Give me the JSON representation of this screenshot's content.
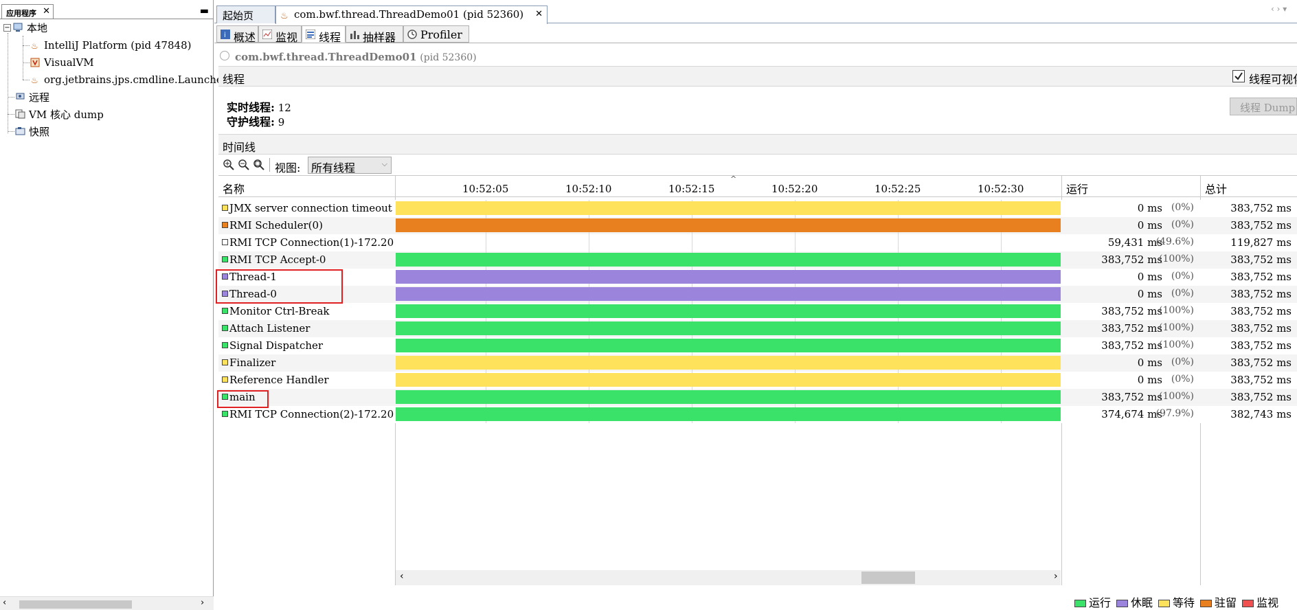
{
  "left_panel": {
    "tab_label": "应用程序",
    "tree": {
      "local": "本地",
      "local_items": [
        "IntelliJ Platform (pid 47848)",
        "VisualVM",
        "org.jetbrains.jps.cmdline.Launcher"
      ],
      "remote": "远程",
      "coredump": "VM 核心 dump",
      "snapshot": "快照"
    }
  },
  "doc_tabs": [
    {
      "label": "起始页"
    },
    {
      "label": "com.bwf.thread.ThreadDemo01 (pid 52360)"
    }
  ],
  "sub_tabs": [
    "概述",
    "监视",
    "线程",
    "抽样器",
    "Profiler"
  ],
  "app_header": "com.bwf.thread.ThreadDemo01",
  "app_pid": "(pid 52360)",
  "threads_section": {
    "title": "线程",
    "visual_checkbox_label": "线程可视化",
    "visual_checked": true,
    "live_label": "实时线程:",
    "live_value": "12",
    "daemon_label": "守护线程:",
    "daemon_value": "9",
    "dump_button": "线程 Dump"
  },
  "timeline": {
    "title": "时间线",
    "view_label": "视图:",
    "view_value": "所有线程",
    "columns": {
      "name": "名称",
      "running": "运行",
      "total": "总计"
    },
    "ticks": [
      "10:52:05",
      "10:52:10",
      "10:52:15",
      "10:52:20",
      "10:52:25",
      "10:52:30"
    ]
  },
  "colors": {
    "running": "#3ae26a",
    "sleeping": "#9b84dc",
    "waiting": "#ffe25c",
    "parked": "#e88020",
    "monitor": "#f05050"
  },
  "threads": [
    {
      "name": "JMX server connection timeout",
      "state": "waiting",
      "running": "0 ms",
      "pct": "(0%)",
      "total": "383,752 ms"
    },
    {
      "name": "RMI Scheduler(0)",
      "state": "parked",
      "running": "0 ms",
      "pct": "(0%)",
      "total": "383,752 ms"
    },
    {
      "name": "RMI TCP Connection(1)-172.20",
      "state": "none",
      "running": "59,431 ms",
      "pct": "(49.6%)",
      "total": "119,827 ms"
    },
    {
      "name": "RMI TCP Accept-0",
      "state": "running",
      "running": "383,752 ms",
      "pct": "(100%)",
      "total": "383,752 ms"
    },
    {
      "name": "Thread-1",
      "state": "sleeping",
      "running": "0 ms",
      "pct": "(0%)",
      "total": "383,752 ms"
    },
    {
      "name": "Thread-0",
      "state": "sleeping",
      "running": "0 ms",
      "pct": "(0%)",
      "total": "383,752 ms"
    },
    {
      "name": "Monitor Ctrl-Break",
      "state": "running",
      "running": "383,752 ms",
      "pct": "(100%)",
      "total": "383,752 ms"
    },
    {
      "name": "Attach Listener",
      "state": "running",
      "running": "383,752 ms",
      "pct": "(100%)",
      "total": "383,752 ms"
    },
    {
      "name": "Signal Dispatcher",
      "state": "running",
      "running": "383,752 ms",
      "pct": "(100%)",
      "total": "383,752 ms"
    },
    {
      "name": "Finalizer",
      "state": "waiting",
      "running": "0 ms",
      "pct": "(0%)",
      "total": "383,752 ms"
    },
    {
      "name": "Reference Handler",
      "state": "waiting",
      "running": "0 ms",
      "pct": "(0%)",
      "total": "383,752 ms"
    },
    {
      "name": "main",
      "state": "running",
      "running": "383,752 ms",
      "pct": "(100%)",
      "total": "383,752 ms"
    },
    {
      "name": "RMI TCP Connection(2)-172.20",
      "state": "running",
      "running": "374,674 ms",
      "pct": "(97.9%)",
      "total": "382,743 ms"
    }
  ],
  "legend": [
    {
      "label": "运行",
      "state": "running"
    },
    {
      "label": "休眠",
      "state": "sleeping"
    },
    {
      "label": "等待",
      "state": "waiting"
    },
    {
      "label": "驻留",
      "state": "parked"
    },
    {
      "label": "监视",
      "state": "monitor"
    }
  ]
}
